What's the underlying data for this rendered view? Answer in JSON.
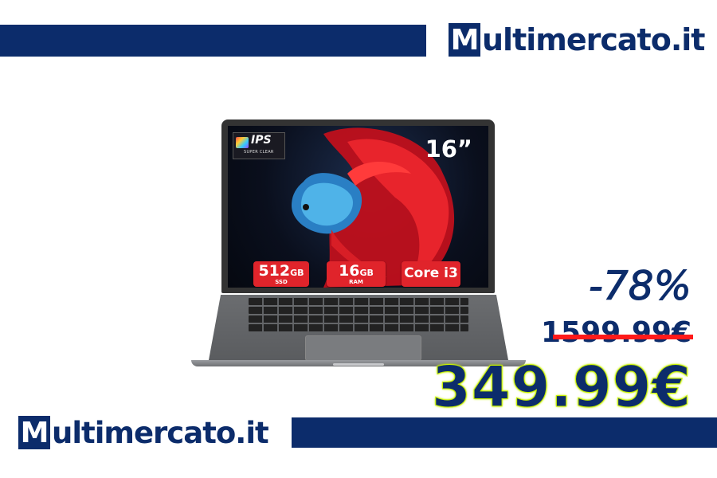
{
  "brand": {
    "logo_top_m": "M",
    "logo_top_rest": "ultimercato.it",
    "logo_bottom_m": "M",
    "logo_bottom_rest": "ultimercato.it",
    "color": "#0c2c6b"
  },
  "product": {
    "screen_badge": {
      "title": "IPS",
      "subtitle": "SUPER CLEAR"
    },
    "screen_size": "16”",
    "specs": [
      {
        "value": "512",
        "unit": "GB",
        "sub": "SSD"
      },
      {
        "value": "16",
        "unit": "GB",
        "sub": "RAM"
      },
      {
        "value": "Core i3",
        "unit": "",
        "sub": ""
      }
    ]
  },
  "pricing": {
    "discount": "-78%",
    "old_price": "1599.99€",
    "new_price": "349.99€",
    "accent": "#c7f000",
    "strike_color": "#ff1a1a"
  }
}
